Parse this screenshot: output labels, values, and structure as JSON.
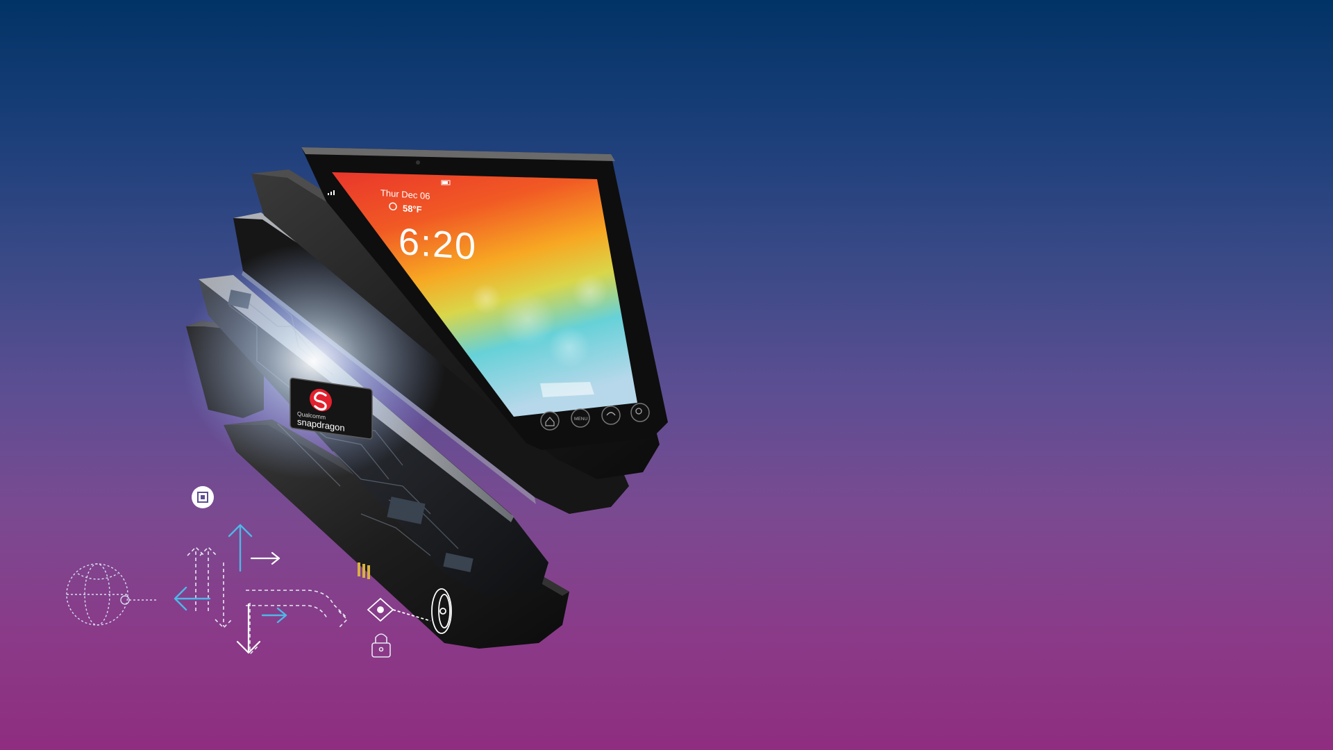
{
  "phone": {
    "status_date": "Thur Dec 06",
    "weather": "58°F",
    "time": "6:20",
    "nav_button_menu": "MENU"
  },
  "chip": {
    "brand_small": "Qualcomm",
    "brand_large": "snapdragon"
  },
  "colors": {
    "bg_top": "#013366",
    "bg_bottom": "#8f2d80",
    "accent_blue": "#4db8e8",
    "snapdragon_red": "#e3212e"
  },
  "icons": [
    "chip-icon",
    "globe-icon",
    "arrow-up-icon",
    "arrow-left-icon",
    "arrow-down-icon",
    "arrow-right-icon",
    "lock-icon",
    "eye-icon",
    "ring-sensor-icon"
  ]
}
